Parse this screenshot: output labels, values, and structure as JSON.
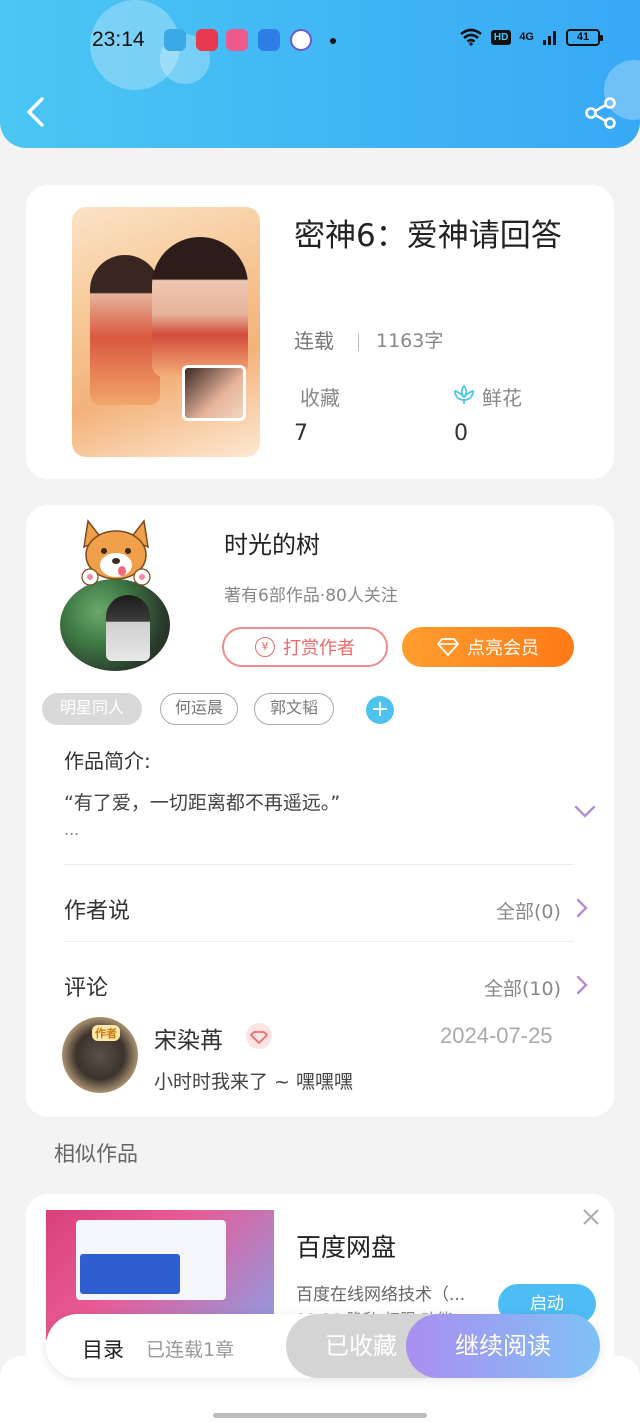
{
  "status_bar": {
    "time": "23:14",
    "hd": "HD",
    "network": "4G",
    "battery": "41"
  },
  "nav": {
    "back_icon": "chevron-left-icon",
    "share_icon": "share-icon"
  },
  "book": {
    "title": "密神6：爱神请回答",
    "status": "连载",
    "word_count": "1163字",
    "stats": [
      {
        "label": "收藏",
        "value": "7"
      },
      {
        "label": "鲜花",
        "value": "0",
        "icon": "flower-icon"
      }
    ]
  },
  "author": {
    "name": "时光的树",
    "meta": "著有6部作品·80人关注",
    "tip_button": "打赏作者",
    "vip_button": "点亮会员"
  },
  "tags": [
    "明星同人",
    "何运晨",
    "郭文韬"
  ],
  "intro": {
    "title": "作品简介:",
    "text": "“有了爱，一切距离都不再遥远。”",
    "more": "..."
  },
  "author_says": {
    "title": "作者说",
    "link": "全部(0)"
  },
  "comments": {
    "title": "评论",
    "link": "全部(10)",
    "items": [
      {
        "badge": "作者",
        "name": "宋染苒",
        "date": "2024-07-25",
        "text": "小时时我来了 ~ 嘿嘿嘿"
      }
    ]
  },
  "similar": {
    "title": "相似作品"
  },
  "ad": {
    "name": "百度网盘",
    "desc": "百度在线网络技术（...",
    "desc2": "12.19 隐私  权限  功能",
    "button": "启动"
  },
  "bottom_bar": {
    "toc": "目录",
    "serial": "已连载1章",
    "favorite": "已收藏",
    "continue": "继续阅读"
  },
  "colors": {
    "header": "#3fb4f4",
    "accent_orange": "#ff7a18",
    "accent_purple": "#a98ef0",
    "tip_red": "#e86a6a"
  }
}
